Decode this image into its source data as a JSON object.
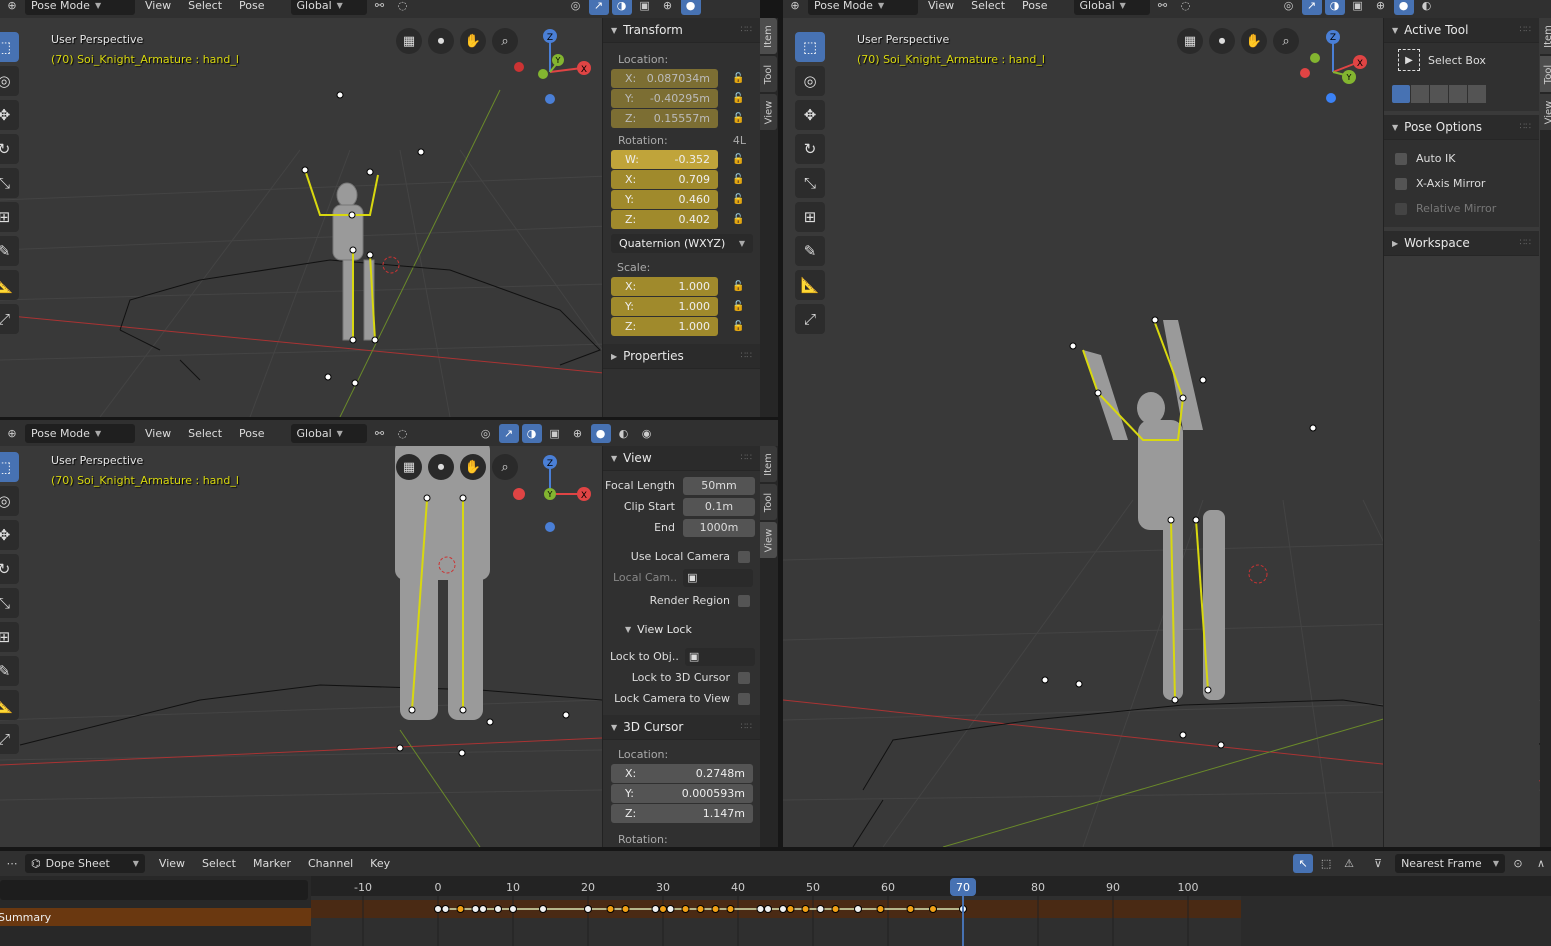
{
  "viewport_header": {
    "mode": "Pose Mode",
    "menus": [
      "View",
      "Select",
      "Pose"
    ],
    "orientation": "Global"
  },
  "overlay": {
    "perspective": "User Perspective",
    "object": "(70) Soi_Knight_Armature : hand_l"
  },
  "gizmo": {
    "x": "X",
    "y": "Y",
    "z": "Z"
  },
  "sidebar_tabs": [
    "Item",
    "Tool",
    "View"
  ],
  "transform_panel": {
    "title": "Transform",
    "location_label": "Location:",
    "location": [
      {
        "axis": "X:",
        "value": "0.087034m"
      },
      {
        "axis": "Y:",
        "value": "-0.40295m"
      },
      {
        "axis": "Z:",
        "value": "0.15557m"
      }
    ],
    "rotation_label": "Rotation:",
    "rotation_lock_label": "4L",
    "rotation": [
      {
        "axis": "W:",
        "value": "-0.352"
      },
      {
        "axis": "X:",
        "value": "0.709"
      },
      {
        "axis": "Y:",
        "value": "0.460"
      },
      {
        "axis": "Z:",
        "value": "0.402"
      }
    ],
    "rotation_mode": "Quaternion (WXYZ)",
    "scale_label": "Scale:",
    "scale": [
      {
        "axis": "X:",
        "value": "1.000"
      },
      {
        "axis": "Y:",
        "value": "1.000"
      },
      {
        "axis": "Z:",
        "value": "1.000"
      }
    ],
    "properties_title": "Properties"
  },
  "view_panel": {
    "title": "View",
    "focal_length_label": "Focal Length",
    "focal_length": "50mm",
    "clip_start_label": "Clip Start",
    "clip_start": "0.1m",
    "clip_end_label": "End",
    "clip_end": "1000m",
    "use_local_camera": "Use Local Camera",
    "local_camera": "Local Cam..",
    "render_region": "Render Region",
    "view_lock_title": "View Lock",
    "lock_to_object": "Lock to Obj..",
    "lock_to_cursor": "Lock to 3D Cursor",
    "lock_camera": "Lock Camera to View",
    "cursor_title": "3D Cursor",
    "cursor_location_label": "Location:",
    "cursor_location": [
      {
        "axis": "X:",
        "value": "0.2748m"
      },
      {
        "axis": "Y:",
        "value": "0.000593m"
      },
      {
        "axis": "Z:",
        "value": "1.147m"
      }
    ],
    "cursor_rotation_label": "Rotation:"
  },
  "tool_panel": {
    "active_tool_title": "Active Tool",
    "active_tool": "Select Box",
    "pose_options_title": "Pose Options",
    "auto_ik": "Auto IK",
    "x_axis_mirror": "X-Axis Mirror",
    "relative_mirror": "Relative Mirror",
    "workspace_title": "Workspace"
  },
  "dopesheet": {
    "editor": "Dope Sheet",
    "menus": [
      "View",
      "Select",
      "Marker",
      "Channel",
      "Key"
    ],
    "snap": "Nearest Frame",
    "summary_label": "Summary",
    "ruler_labels": [
      "-10",
      "0",
      "10",
      "20",
      "30",
      "40",
      "50",
      "60",
      "70",
      "80",
      "90",
      "100"
    ],
    "current_frame": 70,
    "keyframes": [
      0,
      1,
      3,
      5,
      6,
      8,
      10,
      14,
      20,
      23,
      25,
      29,
      30,
      31,
      33,
      35,
      37,
      39,
      43,
      44,
      46,
      47,
      49,
      51,
      53,
      56,
      59,
      63,
      66,
      70
    ],
    "white_keyframes": [
      0,
      1,
      5,
      6,
      8,
      10,
      14,
      20,
      29,
      31,
      43,
      44,
      46,
      51,
      56,
      70
    ]
  },
  "colors": {
    "accent": "#4772b3",
    "bone_yellow": "#d8d80f",
    "keyframe_orange": "#f1a016",
    "summary_bg": "#6a3810"
  }
}
